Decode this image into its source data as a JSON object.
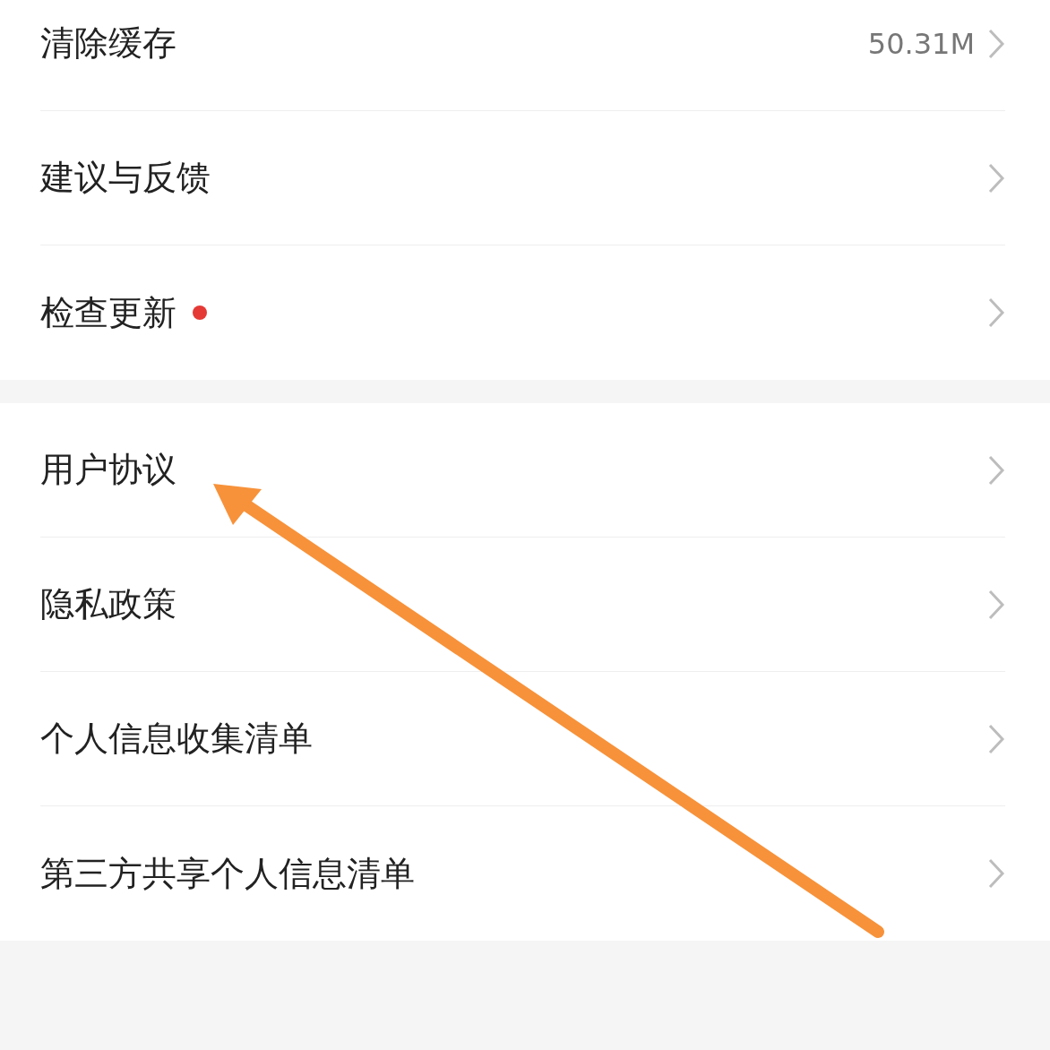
{
  "groups": [
    {
      "items": [
        {
          "label": "清除缓存",
          "value": "50.31M",
          "dot": false
        },
        {
          "label": "建议与反馈",
          "dot": false
        },
        {
          "label": "检查更新",
          "dot": true
        }
      ]
    },
    {
      "items": [
        {
          "label": "用户协议",
          "dot": false
        },
        {
          "label": "隐私政策",
          "dot": false
        },
        {
          "label": "个人信息收集清单",
          "dot": false
        },
        {
          "label": "第三方共享个人信息清单",
          "dot": false
        }
      ]
    }
  ]
}
